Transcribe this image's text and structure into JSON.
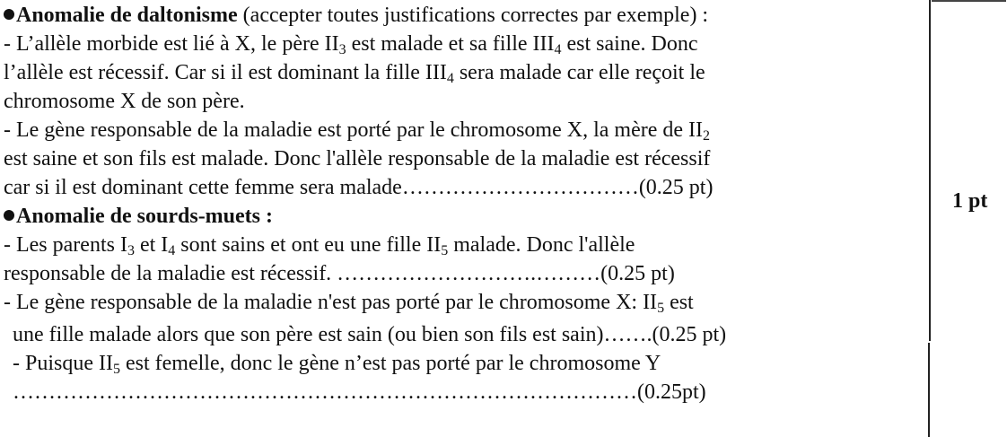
{
  "score": "1 pt",
  "lines": [
    {
      "bold": "Anomalie de daltonisme",
      "text": " (accepter toutes justifications correctes par exemple) :"
    },
    {
      "parts": [
        "- L’allèle morbide est lié à X,  le père II",
        "3",
        " est malade et sa fille III",
        "4",
        " est saine. Donc"
      ]
    },
    {
      "parts": [
        "l’allèle est récessif. Car si il est dominant la fille III",
        "4",
        " sera malade car elle reçoit le"
      ]
    },
    {
      "text": "chromosome X de son père."
    },
    {
      "parts": [
        "- Le gène responsable de la maladie est porté par le chromosome X, la mère de II",
        "2",
        ""
      ]
    },
    {
      "text": "est saine et son fils est malade. Donc l'allèle responsable de la maladie est récessif"
    },
    {
      "text": "car si il est dominant cette femme sera malade……………………………(0.25 pt)"
    },
    {
      "bold": "Anomalie de sourds-muets :",
      "text": ""
    },
    {
      "parts": [
        "- Les parents I",
        "3",
        " et I",
        "4",
        " sont sains et ont eu une fille II",
        "5",
        " malade. Donc l'allèle"
      ]
    },
    {
      "text": "responsable de la maladie est récessif. ……………………….………(0.25 pt)"
    },
    {
      "parts": [
        "- Le gène responsable de la maladie n'est pas porté par le chromosome X: II",
        "5",
        " est"
      ]
    },
    {
      "text": "une fille malade alors que son père est sain (ou bien son fils est sain)…….(0.25 pt)"
    },
    {
      "parts": [
        "- Puisque II",
        "5",
        " est femelle, donc le gène n’est  pas porté par le chromosome Y"
      ]
    },
    {
      "text": "……………………………………………………………………………(0.25pt)"
    }
  ]
}
